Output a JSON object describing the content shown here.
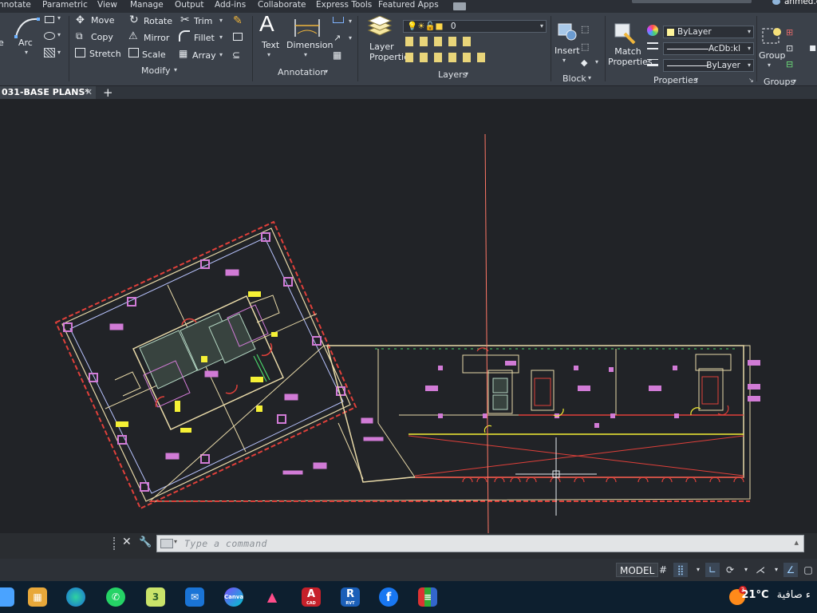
{
  "menubar": {
    "items": [
      "nnotate",
      "Parametric",
      "View",
      "Manage",
      "Output",
      "Add-ins",
      "Collaborate",
      "Express Tools",
      "Featured Apps"
    ],
    "user": "ahmed.er"
  },
  "ribbon": {
    "draw": {
      "arc": "Arc",
      "e": "e"
    },
    "modify": {
      "move": "Move",
      "rotate": "Rotate",
      "trim": "Trim",
      "copy": "Copy",
      "mirror": "Mirror",
      "fillet": "Fillet",
      "stretch": "Stretch",
      "scale": "Scale",
      "array": "Array",
      "title": "Modify"
    },
    "annotation": {
      "text": "Text",
      "dimension": "Dimension",
      "title": "Annotation"
    },
    "layers": {
      "layer_properties": "Layer Properties",
      "current_layer": "0",
      "title": "Layers"
    },
    "block": {
      "insert": "Insert",
      "title": "Block"
    },
    "properties": {
      "match": "Match Properties",
      "color": "ByLayer",
      "linetype": "AcDb:kl",
      "lineweight": "ByLayer",
      "title": "Properties"
    },
    "groups": {
      "group": "Group",
      "title": "Groups"
    }
  },
  "tabs": {
    "file_tab": "031-BASE PLANS*",
    "new_tab": "+"
  },
  "command": {
    "placeholder": "Type a command"
  },
  "status": {
    "model": "MODEL"
  },
  "taskbar": {
    "temperature": "21°C",
    "weather_text": "ء صافية",
    "notification_count": "3",
    "apps": [
      "store",
      "edge",
      "whatsapp",
      "3",
      "mail",
      "canva",
      "autodesk",
      "CAD",
      "RVT",
      "facebook",
      "winrar"
    ],
    "cad_label": "CAD",
    "rvt_label": "RVT",
    "app_3_label": "3"
  },
  "colors": {
    "ribbon_bg": "#3b414a",
    "canvas_bg": "#212327",
    "drawing_wall": "#e8d9a8",
    "drawing_red": "#e0403a",
    "room_tag": "#d17bd6",
    "highlight_yellow": "#f5f035",
    "green_cross": "#4ad36a",
    "crosshair": "#ff7766"
  }
}
